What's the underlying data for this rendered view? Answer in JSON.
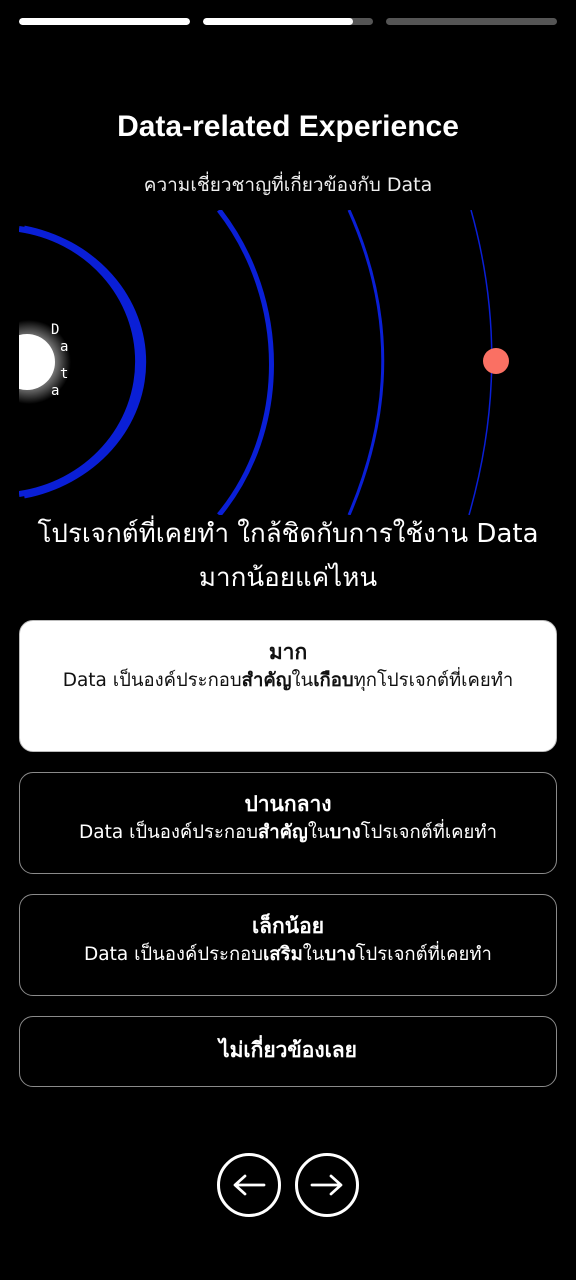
{
  "progress": [
    1.0,
    0.88,
    0.0
  ],
  "header": {
    "title": "Data-related Experience",
    "subtitle": "ความเชี่ยวชาญที่เกี่ยวข้องกับ Data"
  },
  "viz": {
    "center_label": [
      "D",
      "a",
      "t",
      "a"
    ],
    "marker_color": "#FA7063",
    "ring_color": "#0A1FD6"
  },
  "question": {
    "line1": "โปรเจกต์ที่เคยทำ ใกล้ชิดกับการใช้งาน Data",
    "line2": "มากน้อยแค่ไหน"
  },
  "options": [
    {
      "title": "มาก",
      "desc_parts": [
        "Data เป็นองค์ประกอบ",
        "สำคัญ",
        "ใน",
        "เกือบ",
        "ทุกโปรเจกต์ที่เคยทำ"
      ]
    },
    {
      "title": "ปานกลาง",
      "desc_parts": [
        "Data เป็นองค์ประกอบ",
        "สำคัญ",
        "ใน",
        "บาง",
        "โปรเจกต์ที่เคยทำ"
      ]
    },
    {
      "title": "เล็กน้อย",
      "desc_parts": [
        "Data เป็นองค์ประกอบ",
        "เสริม",
        "ใน",
        "บาง",
        "โปรเจกต์ที่เคยทำ"
      ]
    },
    {
      "title": "ไม่เกี่ยวข้องเลย"
    }
  ],
  "nav": {
    "back_icon": "arrow-left-icon",
    "next_icon": "arrow-right-icon"
  }
}
